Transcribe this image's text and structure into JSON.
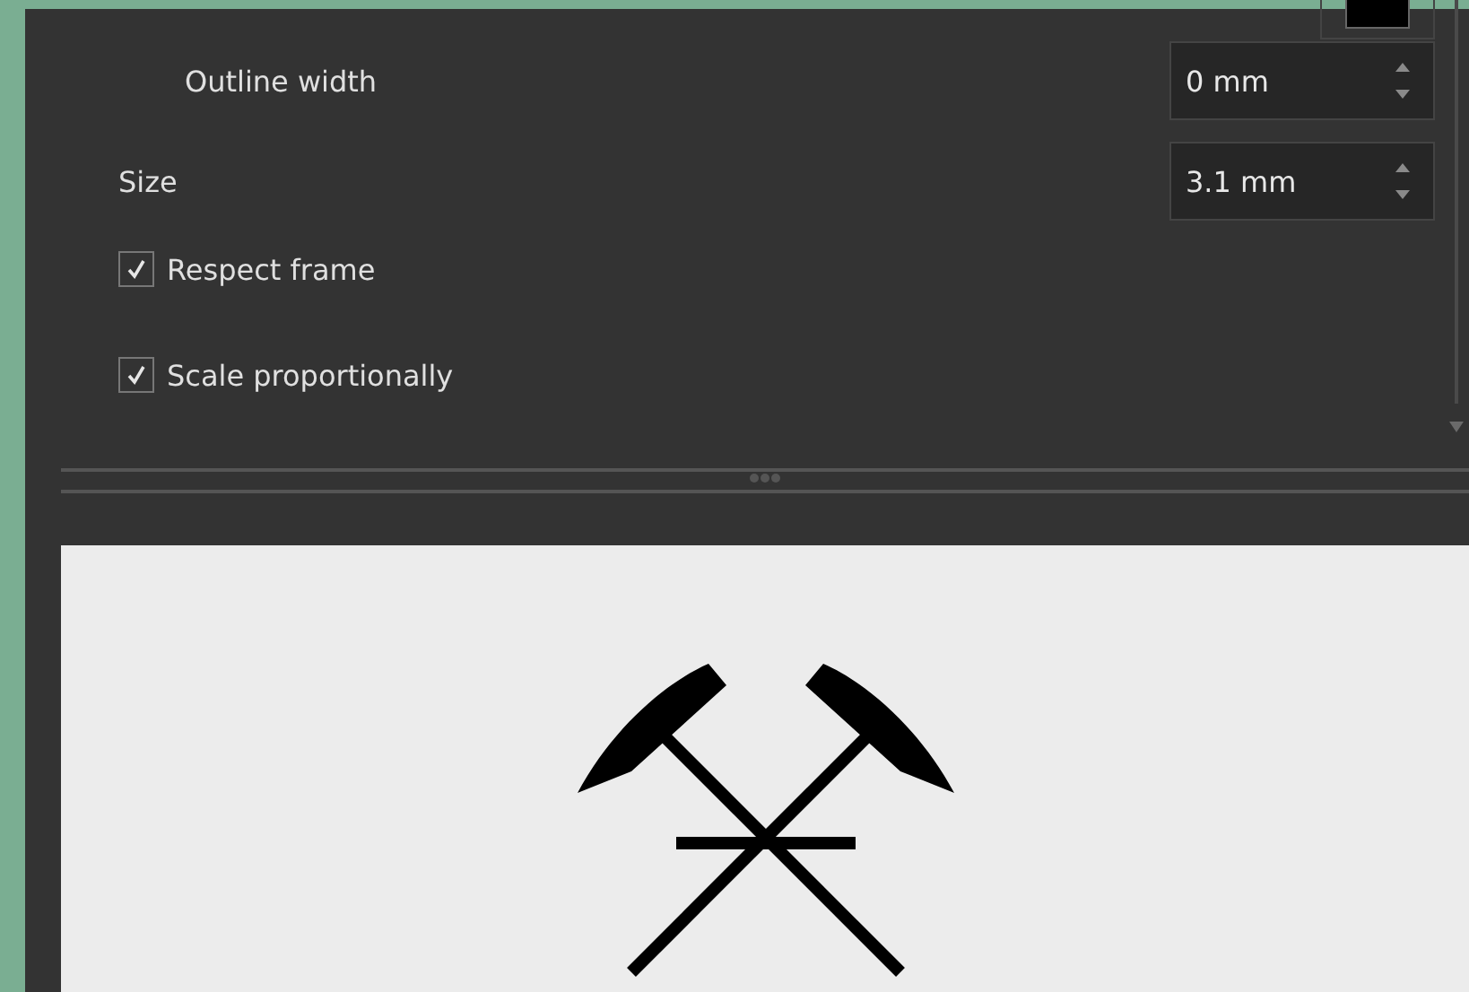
{
  "fields": [
    {
      "label": "Outline width",
      "value": "0 mm",
      "indented": true
    },
    {
      "label": "Size",
      "value": "3.1 mm",
      "indented": false
    }
  ],
  "checkboxes": [
    {
      "label": "Respect frame",
      "checked": true
    },
    {
      "label": "Scale proportionally",
      "checked": true
    }
  ]
}
